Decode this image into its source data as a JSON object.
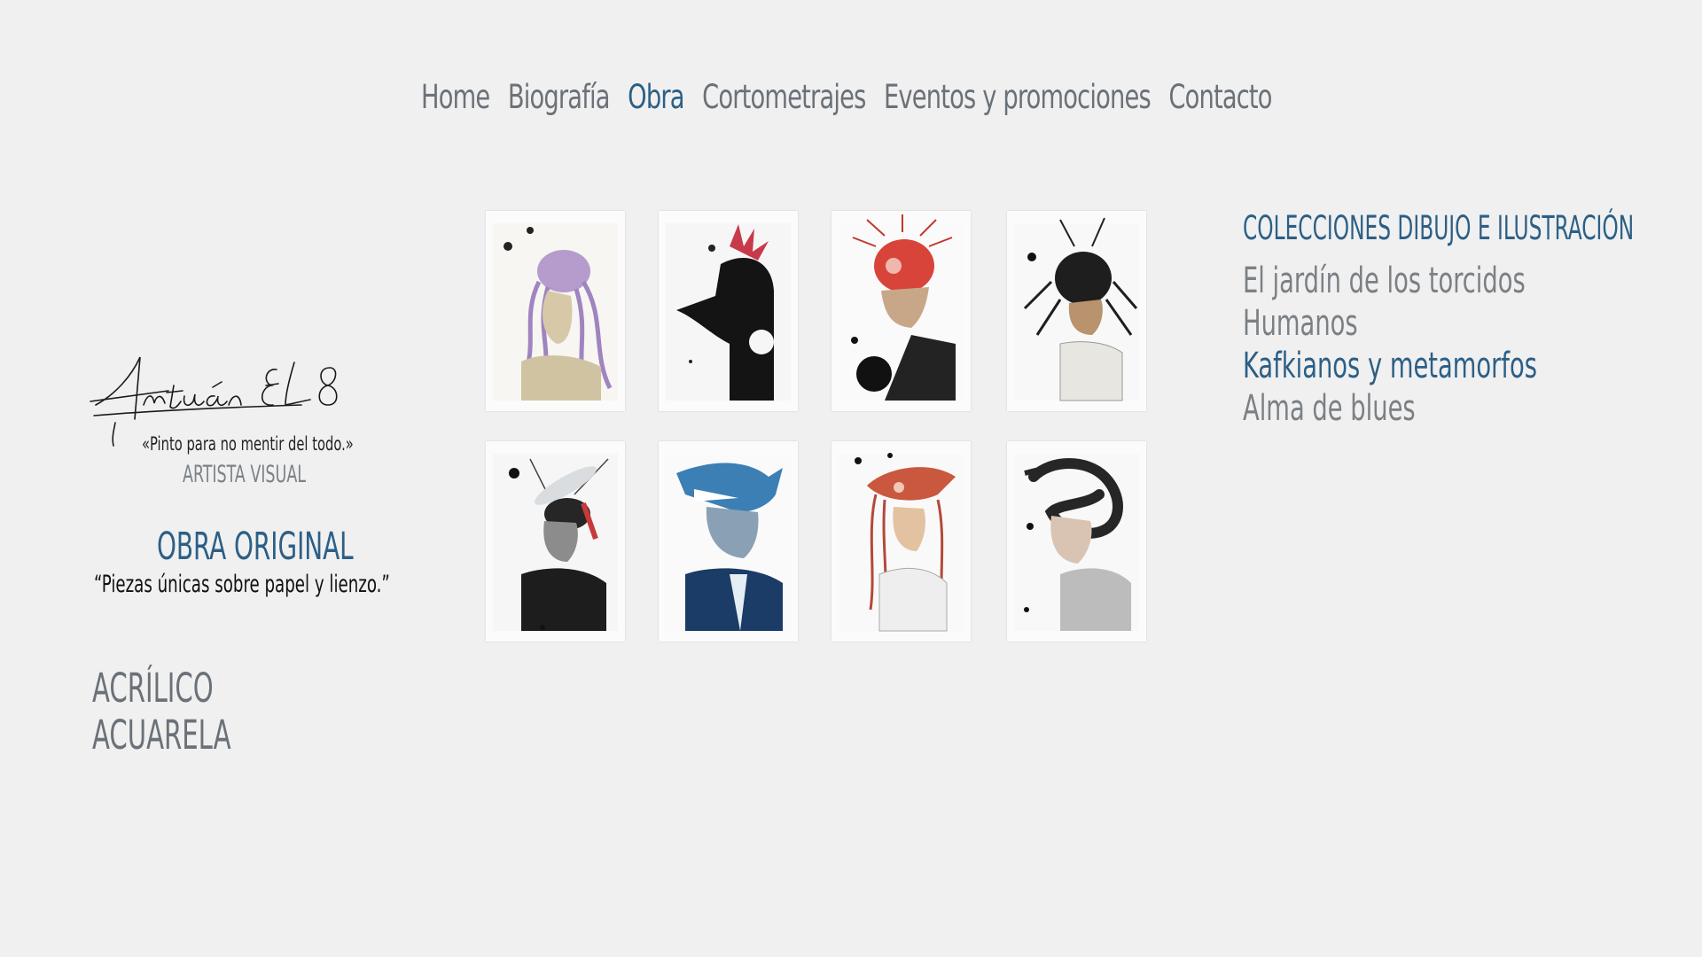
{
  "nav": {
    "items": [
      "Home",
      "Biografía",
      "Obra",
      "Cortometrajes",
      "Eventos y promociones",
      "Contacto"
    ],
    "active": "Obra"
  },
  "brand": {
    "signature": "Antuán EL8",
    "tagline": "«Pinto para no mentir del todo.»",
    "role": "ARTISTA VISUAL"
  },
  "section": {
    "title": "OBRA ORIGINAL",
    "quote": "“Piezas únicas sobre papel y lienzo.”"
  },
  "techniques": [
    "ACRÍLICO",
    "ACUARELA"
  ],
  "gallery": {
    "items": [
      {
        "subject": "octopus-woman",
        "accent": "#a084c0"
      },
      {
        "subject": "crow-man",
        "accent": "#c83a4a"
      },
      {
        "subject": "red-insect-man",
        "accent": "#d8443a"
      },
      {
        "subject": "ant-man",
        "accent": "#2a2a2a"
      },
      {
        "subject": "mosquito-man",
        "accent": "#2a2a2a"
      },
      {
        "subject": "shark-man",
        "accent": "#3b7fb5"
      },
      {
        "subject": "red-squid-girl",
        "accent": "#c9583e"
      },
      {
        "subject": "snake-woman",
        "accent": "#333333"
      }
    ]
  },
  "collections": {
    "title": "COLECCIONES DIBUJO E ILUSTRACIÓN",
    "items": [
      "El jardín de los torcidos",
      "Humanos",
      "Kafkianos y metamorfos",
      "Alma de blues"
    ],
    "active": "Kafkianos y metamorfos"
  },
  "colors": {
    "background": "#f0f0f0",
    "accent": "#2c5f86",
    "text_muted": "#6b7178"
  }
}
